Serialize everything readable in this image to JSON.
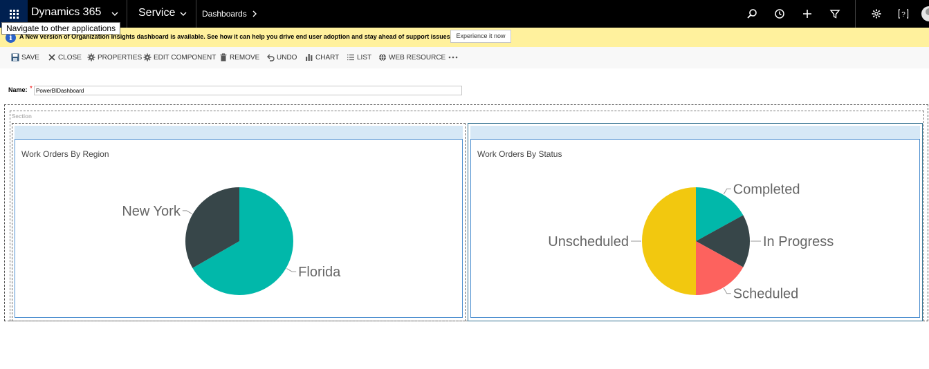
{
  "nav": {
    "app_title": "Dynamics 365",
    "module": "Service",
    "breadcrumb": "Dashboards"
  },
  "tooltip": "Navigate to other applications",
  "notification": {
    "text": "A New version of Organization Insights dashboard is available. See how it can help you drive end user adoption and stay ahead of support issues.",
    "button": "Experience it now"
  },
  "toolbar": {
    "save": "SAVE",
    "close": "CLOSE",
    "properties": "PROPERTIES",
    "edit_component": "EDIT COMPONENT",
    "remove": "REMOVE",
    "undo": "UNDO",
    "chart": "CHART",
    "list": "LIST",
    "web_resource": "WEB RESOURCE"
  },
  "form": {
    "name_label": "Name:",
    "required_mark": "*",
    "name_value": "PowerBIDashboard"
  },
  "section_label": "Section",
  "colors": {
    "teal": "#01b8aa",
    "dark": "#374649",
    "red": "#fd625e",
    "yellow": "#f2c80f",
    "nav_bg": "#000000",
    "notify_bg": "#fff19d"
  },
  "chart_data": [
    {
      "type": "pie",
      "title": "Work Orders By Region",
      "categories": [
        "Florida",
        "New York"
      ],
      "values": [
        66.7,
        33.3
      ],
      "colors": [
        "#01b8aa",
        "#374649"
      ]
    },
    {
      "type": "pie",
      "title": "Work Orders By Status",
      "categories": [
        "Completed",
        "In Progress",
        "Scheduled",
        "Unscheduled"
      ],
      "values": [
        17,
        16,
        17,
        50
      ],
      "colors": [
        "#01b8aa",
        "#374649",
        "#fd625e",
        "#f2c80f"
      ]
    }
  ]
}
